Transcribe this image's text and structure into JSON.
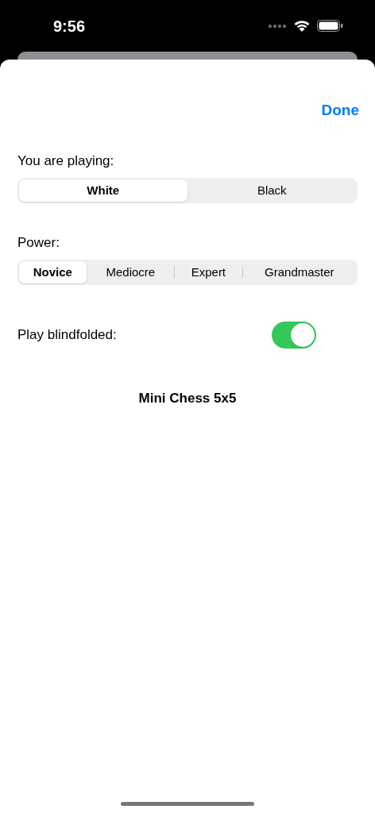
{
  "status_bar": {
    "time": "9:56"
  },
  "nav": {
    "done": "Done"
  },
  "side_label": {
    "label": "You are playing:"
  },
  "side": [
    {
      "label": "White",
      "selected": true
    },
    {
      "label": "Black",
      "selected": false
    }
  ],
  "power_label": {
    "label": "Power:"
  },
  "power": [
    {
      "label": "Novice",
      "selected": true
    },
    {
      "label": "Mediocre",
      "selected": false
    },
    {
      "label": "Expert",
      "selected": false
    },
    {
      "label": "Grandmaster",
      "selected": false
    }
  ],
  "blindfolded": {
    "label": "Play blindfolded:",
    "on": true
  },
  "footer": {
    "title": "Mini Chess 5x5"
  }
}
